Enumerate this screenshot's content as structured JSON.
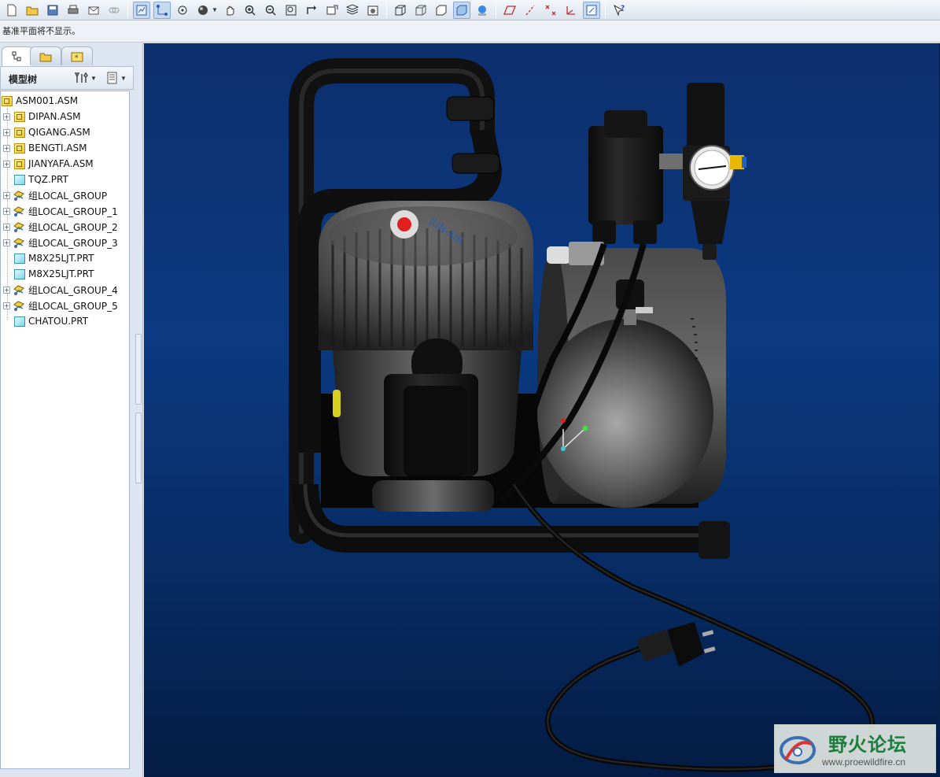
{
  "message_line": "基准平面将不显示。",
  "navigator": {
    "tabs": [
      "model-tree-tab",
      "folder-browser-tab",
      "favorites-tab"
    ],
    "tree_title": "模型树",
    "tree_items": [
      {
        "label": "ASM001.ASM",
        "type": "asm",
        "level": 0,
        "expandable": false
      },
      {
        "label": "DIPAN.ASM",
        "type": "asm",
        "level": 1,
        "expandable": true
      },
      {
        "label": "QIGANG.ASM",
        "type": "asm",
        "level": 1,
        "expandable": true
      },
      {
        "label": "BENGTI.ASM",
        "type": "asm",
        "level": 1,
        "expandable": true
      },
      {
        "label": "JIANYAFA.ASM",
        "type": "asm",
        "level": 1,
        "expandable": true
      },
      {
        "label": "TQZ.PRT",
        "type": "prt",
        "level": 1,
        "expandable": false
      },
      {
        "label": "组LOCAL_GROUP",
        "type": "grp",
        "level": 1,
        "expandable": true
      },
      {
        "label": "组LOCAL_GROUP_1",
        "type": "grp",
        "level": 1,
        "expandable": true
      },
      {
        "label": "组LOCAL_GROUP_2",
        "type": "grp",
        "level": 1,
        "expandable": true
      },
      {
        "label": "组LOCAL_GROUP_3",
        "type": "grp",
        "level": 1,
        "expandable": true
      },
      {
        "label": "M8X25LJT.PRT",
        "type": "prt",
        "level": 1,
        "expandable": false
      },
      {
        "label": "M8X25LJT.PRT",
        "type": "prt",
        "level": 1,
        "expandable": false
      },
      {
        "label": "组LOCAL_GROUP_4",
        "type": "grp",
        "level": 1,
        "expandable": true
      },
      {
        "label": "组LOCAL_GROUP_5",
        "type": "grp",
        "level": 1,
        "expandable": true
      },
      {
        "label": "CHATOU.PRT",
        "type": "prt",
        "level": 1,
        "expandable": false
      }
    ]
  },
  "model": {
    "brand_text": "JUN-AIR"
  },
  "watermark": {
    "title": "野火论坛",
    "url": "www.proewildfire.cn"
  },
  "colors": {
    "viewport_top": "#0c2f6d",
    "viewport_bottom": "#041c45",
    "accent_red": "#e02020",
    "watermark_green": "#1a7f3a"
  }
}
